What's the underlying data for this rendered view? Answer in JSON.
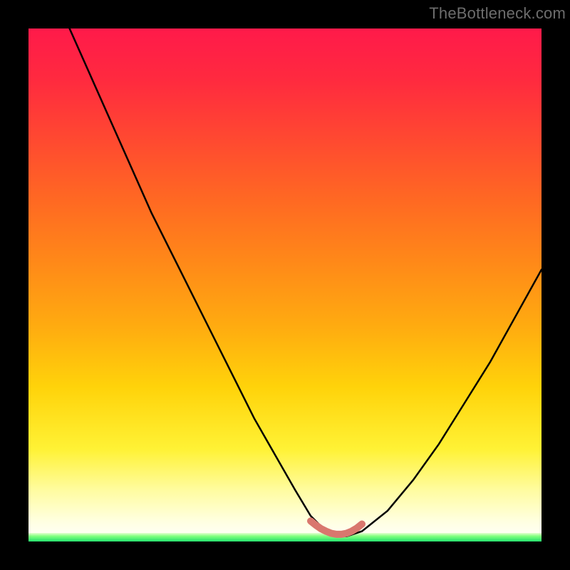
{
  "watermark": "TheBottleneck.com",
  "chart_data": {
    "type": "line",
    "title": "",
    "xlabel": "",
    "ylabel": "",
    "xlim": [
      0,
      100
    ],
    "ylim": [
      0,
      100
    ],
    "series": [
      {
        "name": "bottleneck-curve",
        "x": [
          8,
          12,
          16,
          20,
          24,
          28,
          32,
          36,
          40,
          44,
          48,
          52,
          55,
          58,
          60,
          62,
          65,
          70,
          75,
          80,
          85,
          90,
          95,
          100
        ],
        "values": [
          100,
          91,
          82,
          73,
          64,
          56,
          48,
          40,
          32,
          24,
          17,
          10,
          5,
          2,
          1,
          1,
          2,
          6,
          12,
          19,
          27,
          35,
          44,
          53
        ]
      },
      {
        "name": "flat-highlight",
        "x": [
          55,
          56,
          57,
          58,
          59,
          60,
          61,
          62,
          63,
          64,
          65
        ],
        "values": [
          4,
          3.2,
          2.5,
          2.0,
          1.6,
          1.4,
          1.4,
          1.6,
          2.0,
          2.6,
          3.4
        ]
      }
    ],
    "colors": {
      "gradient_top": "#ff1a4a",
      "gradient_mid": "#ffd30a",
      "gradient_bottom": "#25e06e",
      "curve": "#000000",
      "highlight": "#d9776e"
    }
  }
}
